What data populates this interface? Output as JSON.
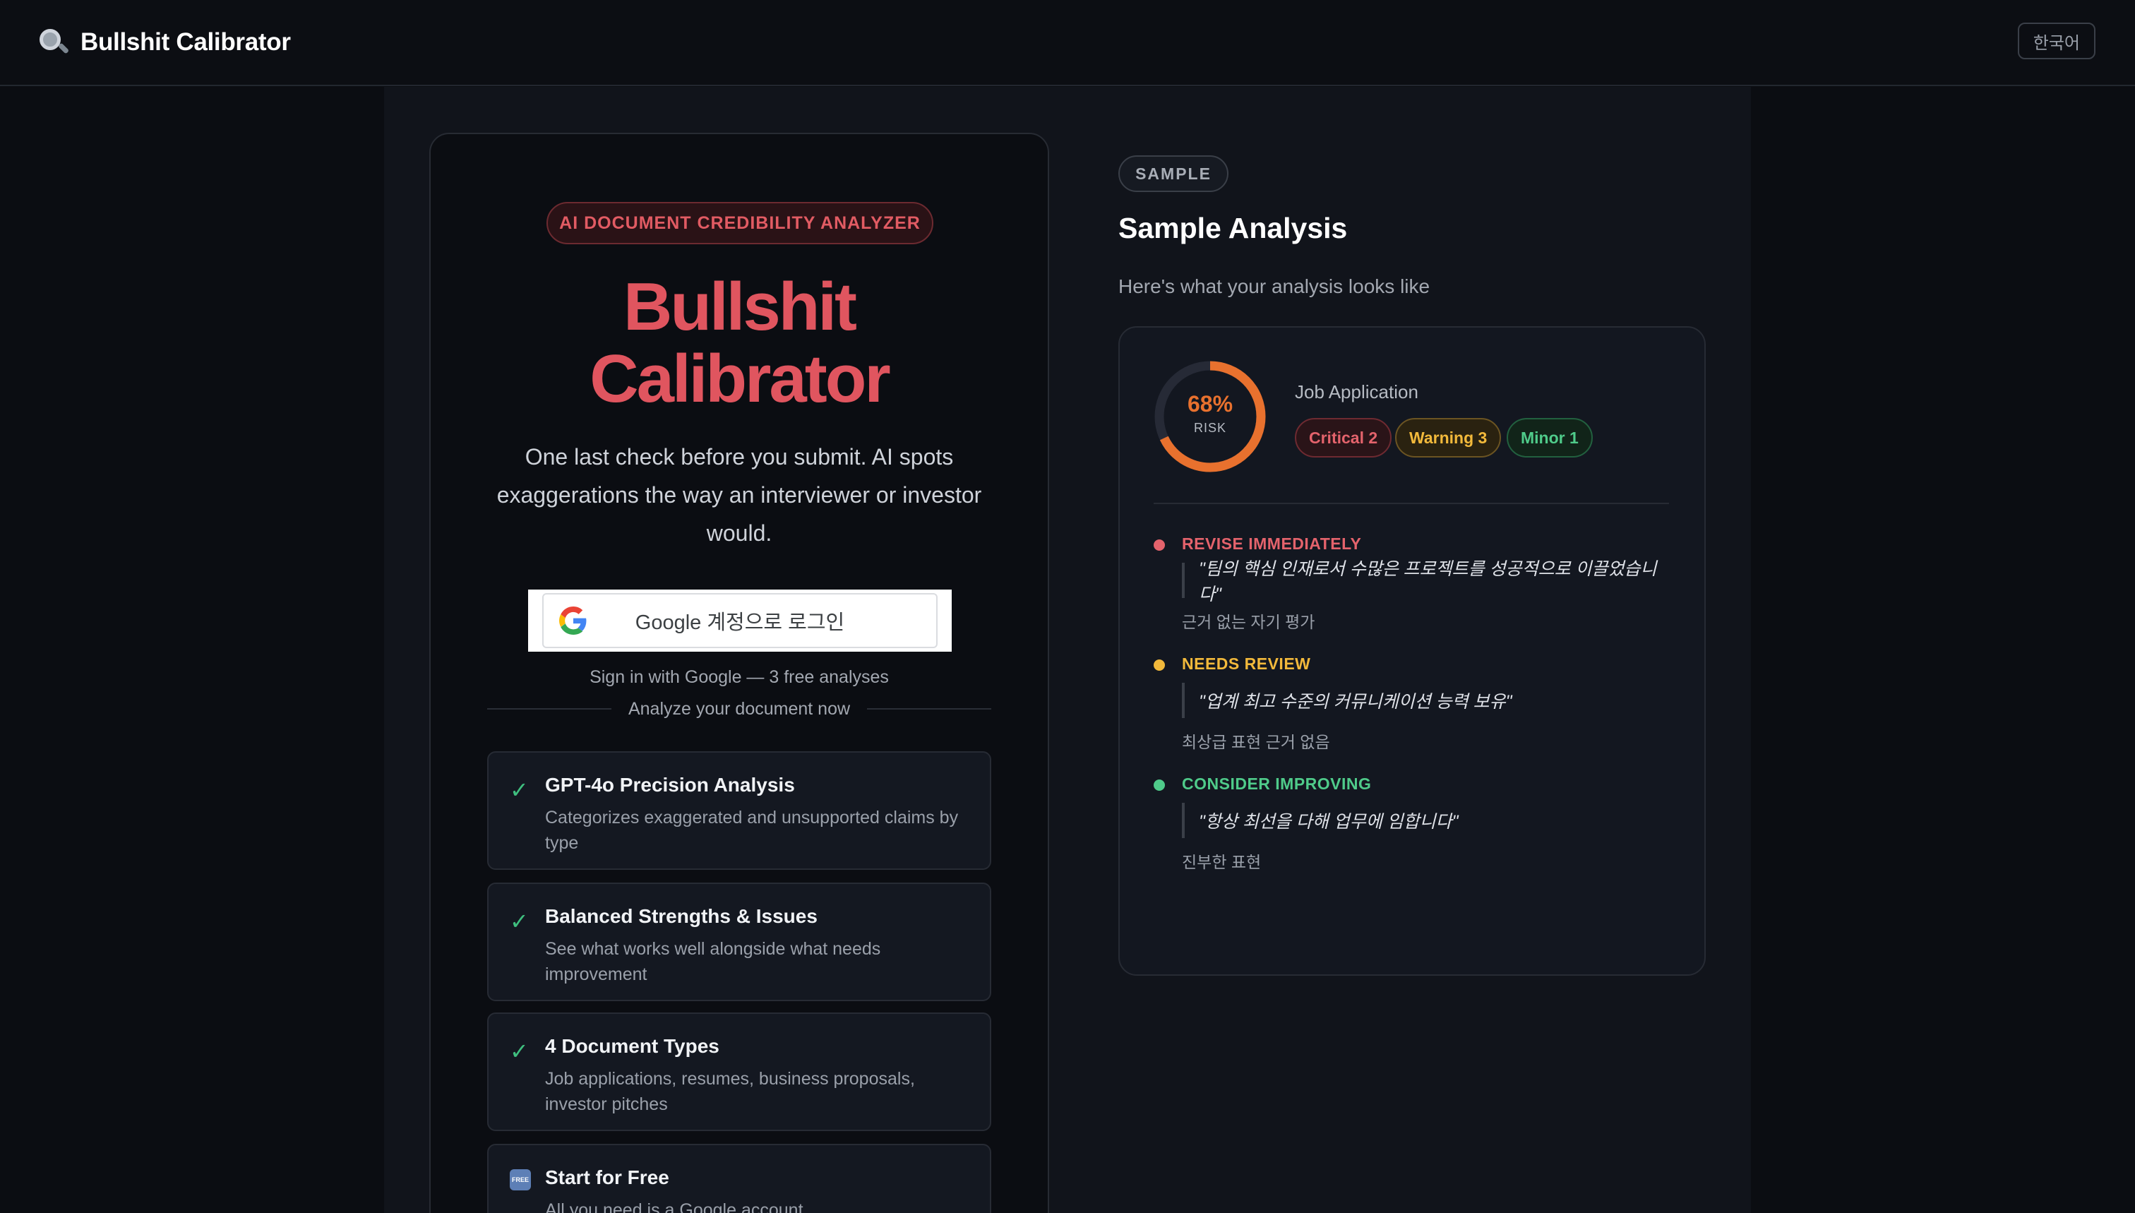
{
  "header": {
    "brand_icon": "magnifying-glass-icon",
    "brand_title": "Bullshit Calibrator",
    "language_button": "한국어"
  },
  "hero": {
    "badge": "AI DOCUMENT CREDIBILITY ANALYZER",
    "title_line1": "Bullshit",
    "title_line2": "Calibrator",
    "subtitle": "One last check before you submit. AI spots exaggerations the way an interviewer or investor would.",
    "google_button": "Google 계정으로 로그인",
    "signin_note": "Sign in with Google — 3 free analyses",
    "divider_text": "Analyze your document now",
    "accent_color": "#e0555f"
  },
  "features": [
    {
      "icon": "check-icon",
      "title": "GPT-4o Precision Analysis",
      "desc": "Categorizes exaggerated and unsupported claims by type"
    },
    {
      "icon": "check-icon",
      "title": "Balanced Strengths & Issues",
      "desc": "See what works well alongside what needs improvement"
    },
    {
      "icon": "check-icon",
      "title": "4 Document Types",
      "desc": "Job applications, resumes, business proposals, investor pitches"
    },
    {
      "icon": "free-badge-icon",
      "icon_text": "FREE",
      "title": "Start for Free",
      "desc": "All you need is a Google account"
    }
  ],
  "sample": {
    "badge": "SAMPLE",
    "title": "Sample Analysis",
    "subtitle": "Here's what your analysis looks like",
    "risk_percent": 68,
    "risk_text": "68%",
    "risk_label": "RISK",
    "document_type": "Job Application",
    "tags": {
      "critical": "Critical 2",
      "warning": "Warning 3",
      "minor": "Minor 1"
    },
    "issues": [
      {
        "level": "REVISE IMMEDIATELY",
        "color": "#e4636c",
        "quote": "\"팀의 핵심 인재로서 수많은 프로젝트를 성공적으로 이끌었습니다\"",
        "note": "근거 없는 자기 평가"
      },
      {
        "level": "NEEDS REVIEW",
        "color": "#f2b93b",
        "quote": "\"업계 최고 수준의 커뮤니케이션 능력 보유\"",
        "note": "최상급 표현 근거 없음"
      },
      {
        "level": "CONSIDER IMPROVING",
        "color": "#4fcb8a",
        "quote": "\"항상 최선을 다해 업무에 임합니다\"",
        "note": "진부한 표현"
      }
    ]
  }
}
